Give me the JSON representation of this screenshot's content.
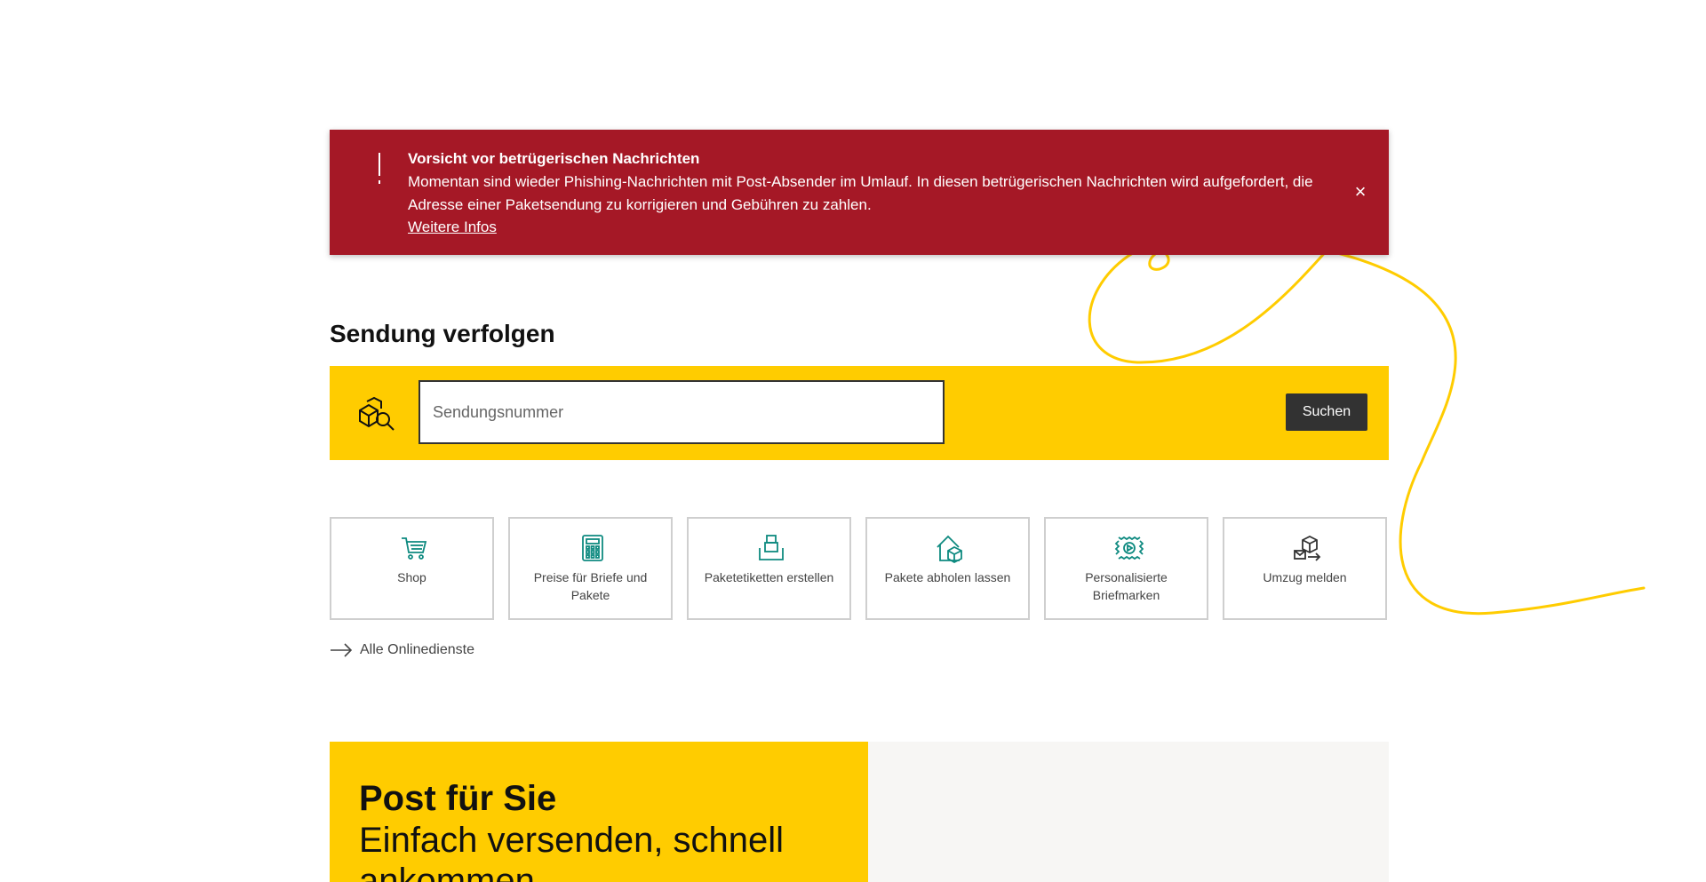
{
  "alert": {
    "title": "Vorsicht vor betrügerischen Nachrichten",
    "text": "Momentan sind wieder Phishing-Nachrichten mit Post-Absender im Umlauf. In diesen betrügerischen Nachrichten wird aufgefordert, die Adresse einer Paketsendung zu korrigieren und Gebühren zu zahlen.",
    "link_label": "Weitere Infos",
    "close_icon": "close-icon",
    "icon": "exclamation-icon"
  },
  "tracking": {
    "title": "Sendung verfolgen",
    "input_placeholder": "Sendungsnummer",
    "input_value": "",
    "button_label": "Suchen",
    "icon": "package-search-icon"
  },
  "services": {
    "tiles": [
      {
        "label": "Shop",
        "icon": "shopping-cart-icon"
      },
      {
        "label": "Preise für Briefe und Pakete",
        "icon": "calculator-icon"
      },
      {
        "label": "Paketetiketten erstellen",
        "icon": "parcel-label-icon"
      },
      {
        "label": "Pakete abholen lassen",
        "icon": "house-parcel-icon"
      },
      {
        "label": "Personalisierte Briefmarken",
        "icon": "stamp-icon"
      },
      {
        "label": "Umzug melden",
        "icon": "moving-boxes-icon"
      }
    ],
    "all_link_label": "Alle Onlinedienste"
  },
  "promo": {
    "title": "Post für Sie",
    "subtitle": "Einfach versenden, schnell ankommen"
  },
  "colors": {
    "brand_yellow": "#ffcc00",
    "alert_red": "#a51826",
    "icon_teal": "#0e8a80",
    "button_dark": "#323232"
  }
}
